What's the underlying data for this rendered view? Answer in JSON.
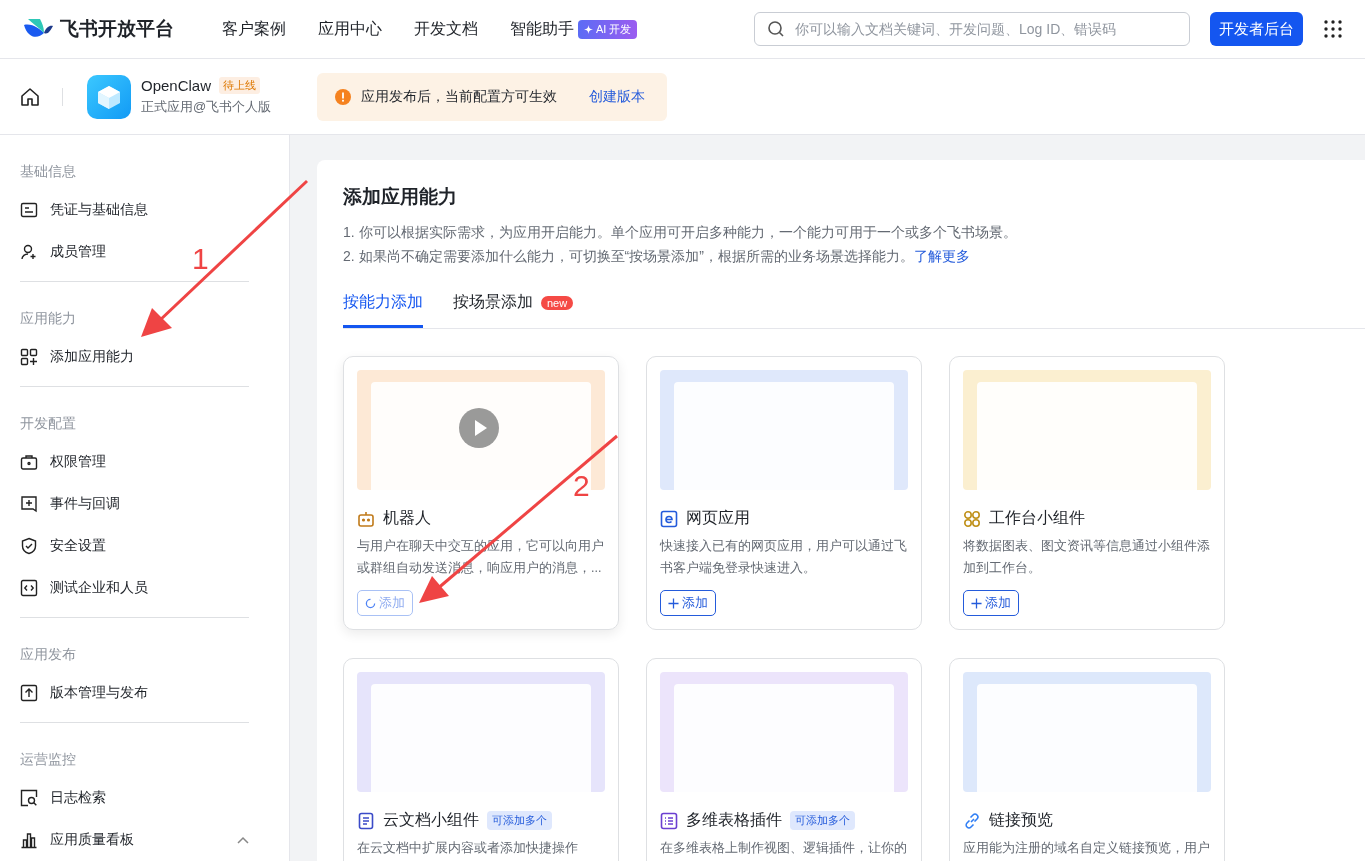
{
  "topbar": {
    "brand": "飞书开放平台",
    "nav": [
      {
        "label": "客户案例"
      },
      {
        "label": "应用中心"
      },
      {
        "label": "开发文档"
      },
      {
        "label": "智能助手",
        "badge": "AI 开发"
      }
    ],
    "search": {
      "placeholder": "你可以输入文档关键词、开发问题、Log ID、错误码"
    },
    "console_button": "开发者后台"
  },
  "app_bar": {
    "app_name": "OpenClaw",
    "status": "待上线",
    "subtitle": "正式应用@飞书个人版",
    "notice": "应用发布后，当前配置方可生效",
    "notice_link": "创建版本"
  },
  "sidebar": {
    "groups": [
      {
        "title": "基础信息",
        "items": [
          {
            "label": "凭证与基础信息"
          },
          {
            "label": "成员管理"
          }
        ]
      },
      {
        "title": "应用能力",
        "items": [
          {
            "label": "添加应用能力"
          }
        ]
      },
      {
        "title": "开发配置",
        "items": [
          {
            "label": "权限管理"
          },
          {
            "label": "事件与回调"
          },
          {
            "label": "安全设置"
          },
          {
            "label": "测试企业和人员"
          }
        ]
      },
      {
        "title": "应用发布",
        "items": [
          {
            "label": "版本管理与发布"
          }
        ]
      },
      {
        "title": "运营监控",
        "items": [
          {
            "label": "日志检索"
          },
          {
            "label": "应用质量看板",
            "expanded": true
          }
        ]
      }
    ]
  },
  "content": {
    "title": "添加应用能力",
    "notes": [
      "1. 你可以根据实际需求，为应用开启能力。单个应用可开启多种能力，一个能力可用于一个或多个飞书场景。",
      "2. 如果尚不确定需要添加什么能力，可切换至“按场景添加”，根据所需的业务场景选择能力。"
    ],
    "learn_more": "了解更多",
    "tabs": [
      {
        "label": "按能力添加",
        "selected": true
      },
      {
        "label": "按场景添加",
        "selected": false,
        "badge": "new"
      }
    ],
    "cards": [
      {
        "title": "机器人",
        "description": "与用户在聊天中交互的应用，它可以向用户或群组自动发送消息，响应用户的消息，...",
        "button": {
          "label": "添加",
          "loading": true
        }
      },
      {
        "title": "网页应用",
        "description": "快速接入已有的网页应用，用户可以通过飞书客户端免登录快速进入。",
        "button": {
          "label": "添加",
          "loading": false
        }
      },
      {
        "title": "工作台小组件",
        "description": "将数据图表、图文资讯等信息通过小组件添加到工作台。",
        "button": {
          "label": "添加",
          "loading": false
        }
      },
      {
        "title": "云文档小组件",
        "badge": "可添加多个",
        "description": "在云文档中扩展内容或者添加快捷操作"
      },
      {
        "title": "多维表格插件",
        "badge": "可添加多个",
        "description": "在多维表格上制作视图、逻辑插件，让你的"
      },
      {
        "title": "链接预览",
        "description": "应用能为注册的域名自定义链接预览，用户"
      }
    ]
  },
  "annotations": [
    {
      "label": "1"
    },
    {
      "label": "2"
    }
  ]
}
